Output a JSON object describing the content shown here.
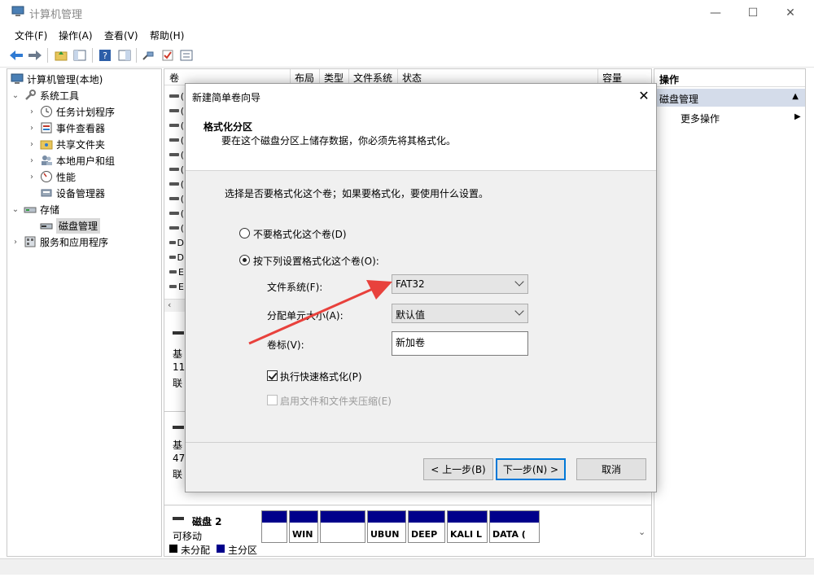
{
  "window": {
    "title": "计算机管理",
    "controls": {
      "minimize": "—",
      "maximize": "☐",
      "close": "✕"
    }
  },
  "menu": [
    "文件(F)",
    "操作(A)",
    "查看(V)",
    "帮助(H)"
  ],
  "tree": {
    "root": "计算机管理(本地)",
    "items": [
      {
        "label": "系统工具",
        "level": 1,
        "expanded": true
      },
      {
        "label": "任务计划程序",
        "level": 2
      },
      {
        "label": "事件查看器",
        "level": 2
      },
      {
        "label": "共享文件夹",
        "level": 2
      },
      {
        "label": "本地用户和组",
        "level": 2
      },
      {
        "label": "性能",
        "level": 2
      },
      {
        "label": "设备管理器",
        "level": 2
      },
      {
        "label": "存储",
        "level": 1,
        "expanded": true
      },
      {
        "label": "磁盘管理",
        "level": 2,
        "selected": true
      },
      {
        "label": "服务和应用程序",
        "level": 1
      }
    ]
  },
  "columns": [
    "卷",
    "布局",
    "类型",
    "文件系统",
    "状态",
    "容量"
  ],
  "volume_rows": [
    "(",
    "(",
    "(",
    "(",
    "(",
    "(",
    "(",
    "(",
    "(",
    "(",
    "D",
    "D",
    "E",
    "E"
  ],
  "disk_side": {
    "disk0": [
      "基",
      "11",
      "联"
    ],
    "disk1": [
      "基",
      "47",
      "联"
    ]
  },
  "actions": {
    "header": "操作",
    "section": "磁盘管理",
    "more": "更多操作"
  },
  "dialog": {
    "title": "新建简单卷向导",
    "heading": "格式化分区",
    "subheading": "要在这个磁盘分区上储存数据，你必须先将其格式化。",
    "intro": "选择是否要格式化这个卷；如果要格式化，要使用什么设置。",
    "option_no_format": "不要格式化这个卷(D)",
    "option_format": "按下列设置格式化这个卷(O):",
    "fs_label": "文件系统(F):",
    "fs_value": "FAT32",
    "alloc_label": "分配单元大小(A):",
    "alloc_value": "默认值",
    "vol_label": "卷标(V):",
    "vol_value": "新加卷",
    "quick_format": "执行快速格式化(P)",
    "compression": "启用文件和文件夹压缩(E)",
    "btn_back": "< 上一步(B)",
    "btn_next": "下一步(N) >",
    "btn_cancel": "取消"
  },
  "disk2": {
    "name": "磁盘 2",
    "type": "可移动",
    "partitions": [
      "",
      "WIN",
      "",
      "UBUN",
      "DEEP",
      "KALI L",
      "DATA ("
    ]
  },
  "legend": {
    "unallocated": "未分配",
    "primary": "主分区",
    "unallocated_color": "#000000",
    "primary_color": "#00008b"
  },
  "colors": {
    "arrow": "#e8413c",
    "dialog_default_button": "#0078d7",
    "section_highlight": "#d4dcea"
  }
}
